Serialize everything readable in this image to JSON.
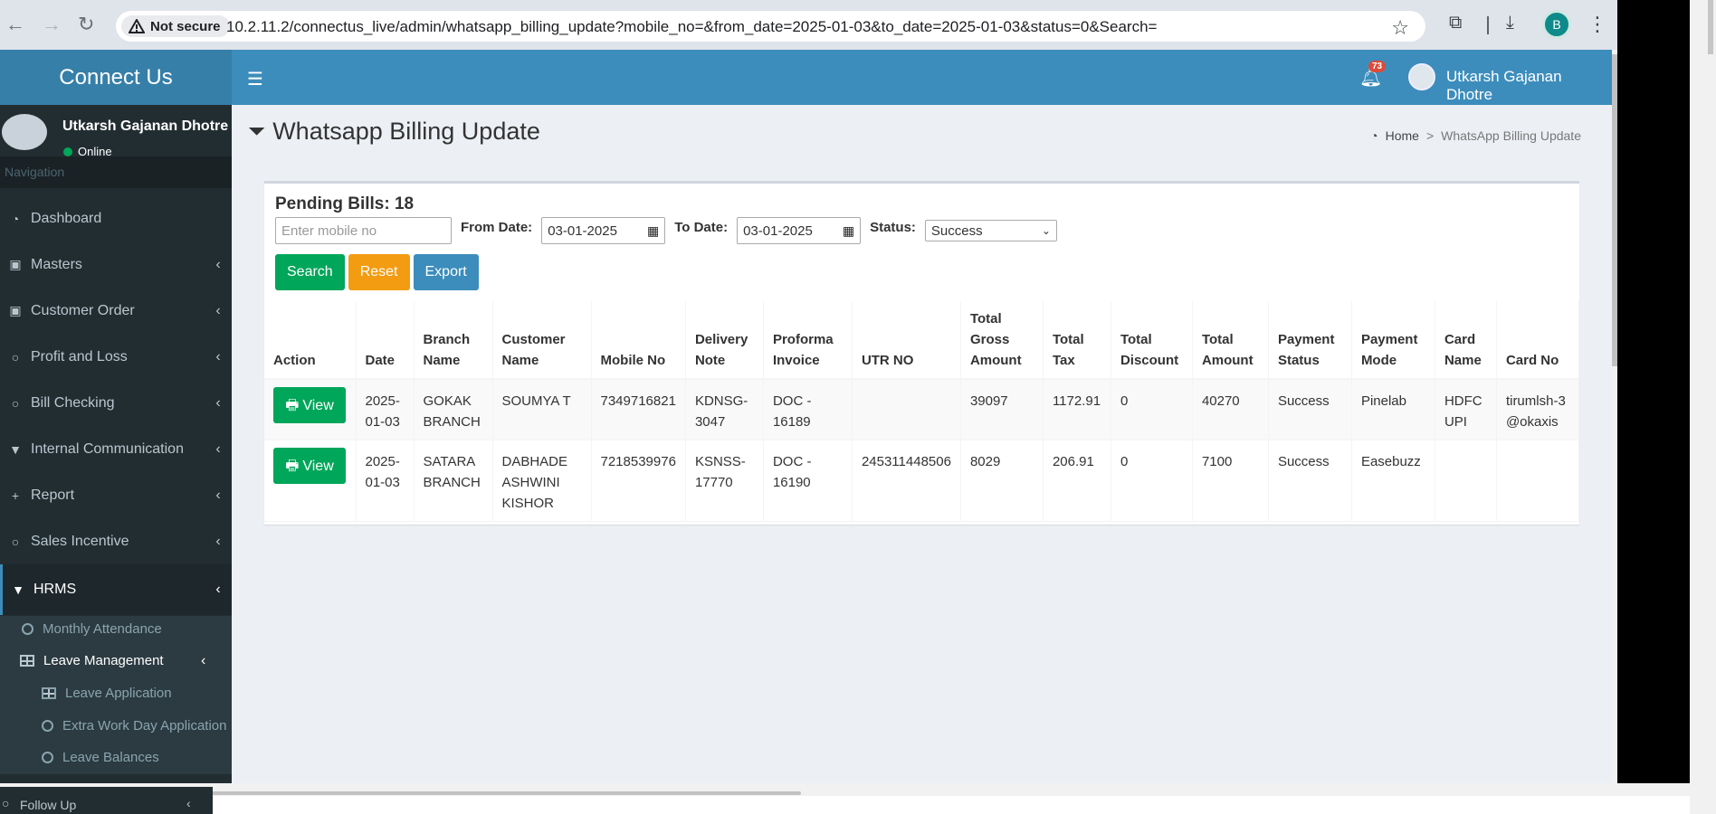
{
  "browser": {
    "security_label": "Not secure",
    "url": "10.2.11.2/connectus_live/admin/whatsapp_billing_update?mobile_no=&from_date=2025-01-03&to_date=2025-01-03&status=0&Search=",
    "profile_initial": "B"
  },
  "header": {
    "brand": "Connect Us",
    "notification_count": "73",
    "user_name": "Utkarsh Gajanan Dhotre"
  },
  "sidebar": {
    "user_name": "Utkarsh Gajanan Dhotre",
    "status": "Online",
    "nav_header": "Navigation",
    "items": [
      {
        "label": "Dashboard",
        "icon": "dashboard-icon"
      },
      {
        "label": "Masters",
        "icon": "money-icon"
      },
      {
        "label": "Customer Order",
        "icon": "money-icon"
      },
      {
        "label": "Profit and Loss",
        "icon": "circle-icon"
      },
      {
        "label": "Bill Checking",
        "icon": "circle-icon"
      },
      {
        "label": "Internal Communication",
        "icon": "filter-icon"
      },
      {
        "label": "Report",
        "icon": "plus-icon"
      },
      {
        "label": "Sales Incentive",
        "icon": "circle-icon"
      },
      {
        "label": "HRMS",
        "icon": "filter-icon"
      }
    ],
    "sub_items": {
      "monthly_attendance": "Monthly Attendance",
      "leave_management": "Leave Management",
      "leave_application": "Leave Application",
      "extra_work_day": "Extra Work Day Application",
      "leave_balances": "Leave Balances"
    },
    "partial_item": "Follow Up"
  },
  "page": {
    "title": "Whatsapp Billing Update",
    "breadcrumb_home": "Home",
    "breadcrumb_sep": ">",
    "breadcrumb_current": "WhatsApp Billing Update"
  },
  "filters": {
    "pending_label": "Pending Bills: 18",
    "mobile_placeholder": "Enter mobile no",
    "from_label": "From Date:",
    "from_value": "03-01-2025",
    "to_label": "To Date:",
    "to_value": "03-01-2025",
    "status_label": "Status:",
    "status_value": "Success",
    "search_btn": "Search",
    "reset_btn": "Reset",
    "export_btn": "Export"
  },
  "table": {
    "headers": [
      "Action",
      "Date",
      "Branch Name",
      "Customer Name",
      "Mobile No",
      "Delivery Note",
      "Proforma Invoice",
      "UTR NO",
      "Total Gross Amount",
      "Total Tax",
      "Total Discount",
      "Total Amount",
      "Payment Status",
      "Payment Mode",
      "Card Name",
      "Card No"
    ],
    "view_label": "View",
    "rows": [
      {
        "date": "2025-01-03",
        "branch": "GOKAK BRANCH",
        "customer": "SOUMYA T",
        "mobile": "7349716821",
        "delivery": "KDNSG-3047",
        "proforma": "DOC - 16189",
        "utr": "",
        "gross": "39097",
        "tax": "1172.91",
        "discount": "0",
        "amount": "40270",
        "pay_status": "Success",
        "pay_mode": "Pinelab",
        "card_name": "HDFC UPI",
        "card_no": "tirumlsh-3@okaxis"
      },
      {
        "date": "2025-01-03",
        "branch": "SATARA BRANCH",
        "customer": "DABHADE ASHWINI KISHOR",
        "mobile": "7218539976",
        "delivery": "KSNSS-17770",
        "proforma": "DOC - 16190",
        "utr": "245311448506",
        "gross": "8029",
        "tax": "206.91",
        "discount": "0",
        "amount": "7100",
        "pay_status": "Success",
        "pay_mode": "Easebuzz",
        "card_name": "",
        "card_no": ""
      }
    ]
  }
}
